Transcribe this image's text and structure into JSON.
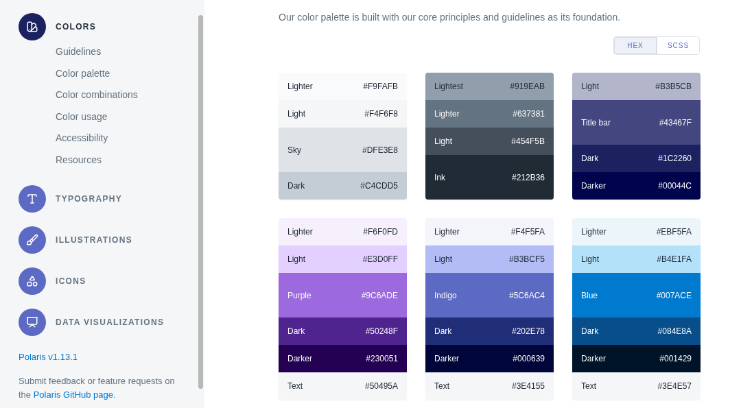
{
  "sidebar": {
    "sections": [
      {
        "label": "COLORS",
        "selected": true,
        "items": [
          {
            "label": "Guidelines"
          },
          {
            "label": "Color palette"
          },
          {
            "label": "Color combinations"
          },
          {
            "label": "Color usage"
          },
          {
            "label": "Accessibility"
          },
          {
            "label": "Resources"
          }
        ]
      },
      {
        "label": "TYPOGRAPHY",
        "selected": false
      },
      {
        "label": "ILLUSTRATIONS",
        "selected": false
      },
      {
        "label": "ICONS",
        "selected": false
      },
      {
        "label": "DATA VISUALIZATIONS",
        "selected": false
      }
    ],
    "version": "Polaris v1.13.1",
    "feedback": {
      "text": "Submit feedback or feature requests on the",
      "link": "Polaris GitHub page",
      "end": "."
    }
  },
  "intro": "Our color palette is built with our core principles and guidelines as its foundation.",
  "format_toggle": [
    {
      "label": "HEX",
      "selected": true
    },
    {
      "label": "SCSS",
      "selected": false
    }
  ],
  "palettes": [
    {
      "swatches": [
        {
          "name": "Lighter",
          "hex": "#F9FAFB",
          "color": "#f9fafb",
          "kind": "shade"
        },
        {
          "name": "Light",
          "hex": "#F4F6F8",
          "color": "#f4f6f8",
          "kind": "shade"
        },
        {
          "name": "Sky",
          "hex": "#DFE3E8",
          "color": "#dfe3e8",
          "kind": "base"
        },
        {
          "name": "Dark",
          "hex": "#C4CDD5",
          "color": "#c4cdd5",
          "kind": "shade"
        }
      ]
    },
    {
      "swatches": [
        {
          "name": "Lightest",
          "hex": "#919EAB",
          "color": "#919eab",
          "kind": "shade"
        },
        {
          "name": "Lighter",
          "hex": "#637381",
          "color": "#637381",
          "kind": "shade"
        },
        {
          "name": "Light",
          "hex": "#454F5B",
          "color": "#454f5b",
          "kind": "shade"
        },
        {
          "name": "Ink",
          "hex": "#212B36",
          "color": "#212b36",
          "kind": "base"
        }
      ]
    },
    {
      "swatches": [
        {
          "name": "Light",
          "hex": "#B3B5CB",
          "color": "#b3b5cb",
          "kind": "shade"
        },
        {
          "name": "Title bar",
          "hex": "#43467F",
          "color": "#43467f",
          "kind": "base"
        },
        {
          "name": "Dark",
          "hex": "#1C2260",
          "color": "#1c2260",
          "kind": "shade"
        },
        {
          "name": "Darker",
          "hex": "#00044C",
          "color": "#00044c",
          "kind": "shade"
        }
      ]
    },
    {
      "swatches": [
        {
          "name": "Lighter",
          "hex": "#F6F0FD",
          "color": "#f6f0fd",
          "kind": "shade"
        },
        {
          "name": "Light",
          "hex": "#E3D0FF",
          "color": "#e3d0ff",
          "kind": "shade"
        },
        {
          "name": "Purple",
          "hex": "#9C6ADE",
          "color": "#9c6ade",
          "kind": "base"
        },
        {
          "name": "Dark",
          "hex": "#50248F",
          "color": "#50248f",
          "kind": "shade"
        },
        {
          "name": "Darker",
          "hex": "#230051",
          "color": "#230051",
          "kind": "shade"
        },
        {
          "name": "Text",
          "hex": "#50495A",
          "color": "#f4f6f8",
          "kind": "shade"
        }
      ]
    },
    {
      "swatches": [
        {
          "name": "Lighter",
          "hex": "#F4F5FA",
          "color": "#f4f5fa",
          "kind": "shade"
        },
        {
          "name": "Light",
          "hex": "#B3BCF5",
          "color": "#b3bcf5",
          "kind": "shade"
        },
        {
          "name": "Indigo",
          "hex": "#5C6AC4",
          "color": "#5c6ac4",
          "kind": "base"
        },
        {
          "name": "Dark",
          "hex": "#202E78",
          "color": "#202e78",
          "kind": "shade"
        },
        {
          "name": "Darker",
          "hex": "#000639",
          "color": "#000639",
          "kind": "shade"
        },
        {
          "name": "Text",
          "hex": "#3E4155",
          "color": "#f4f6f8",
          "kind": "shade"
        }
      ]
    },
    {
      "swatches": [
        {
          "name": "Lighter",
          "hex": "#EBF5FA",
          "color": "#ebf5fa",
          "kind": "shade"
        },
        {
          "name": "Light",
          "hex": "#B4E1FA",
          "color": "#b4e1fa",
          "kind": "shade"
        },
        {
          "name": "Blue",
          "hex": "#007ACE",
          "color": "#007ace",
          "kind": "base"
        },
        {
          "name": "Dark",
          "hex": "#084E8A",
          "color": "#084e8a",
          "kind": "shade"
        },
        {
          "name": "Darker",
          "hex": "#001429",
          "color": "#001429",
          "kind": "shade"
        },
        {
          "name": "Text",
          "hex": "#3E4E57",
          "color": "#f4f6f8",
          "kind": "shade"
        }
      ]
    }
  ]
}
